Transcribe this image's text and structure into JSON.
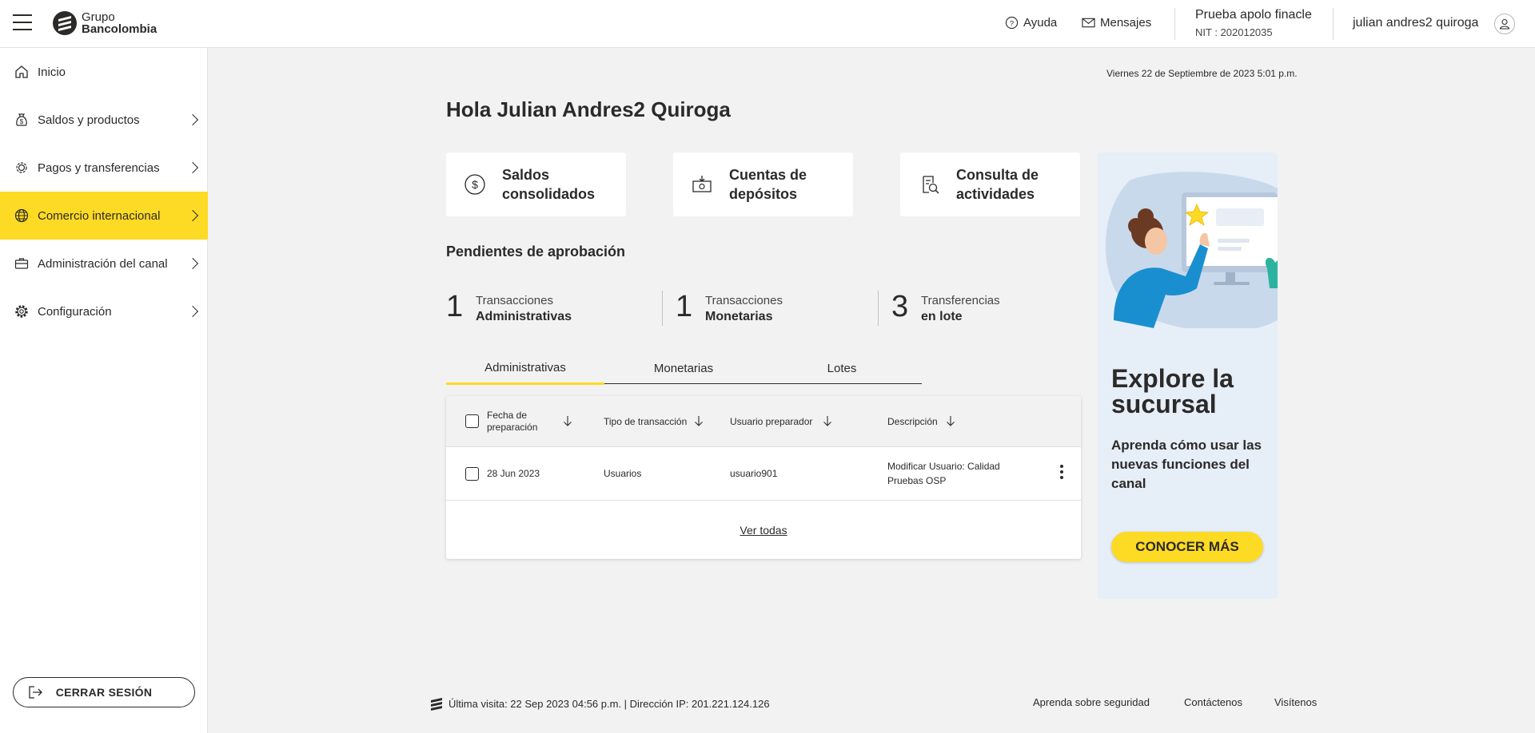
{
  "header": {
    "logo_line1": "Grupo",
    "logo_line2": "Bancolombia",
    "help_label": "Ayuda",
    "messages_label": "Mensajes",
    "company_name": "Prueba apolo finacle",
    "company_nit": "NIT : 202012035",
    "user_name": "julian andres2 quiroga"
  },
  "sidebar": {
    "items": [
      {
        "label": "Inicio",
        "icon": "home-icon"
      },
      {
        "label": "Saldos y productos",
        "icon": "money-bag-icon"
      },
      {
        "label": "Pagos y transferencias",
        "icon": "payment-gear-icon"
      },
      {
        "label": "Comercio internacional",
        "icon": "globe-icon"
      },
      {
        "label": "Administración del canal",
        "icon": "briefcase-icon"
      },
      {
        "label": "Configuración",
        "icon": "gear-icon"
      }
    ],
    "active_index": 3,
    "logout_label": "CERRAR SESIÓN"
  },
  "main": {
    "datetime": "Viernes 22 de Septiembre de 2023 5:01 p.m.",
    "greeting": "Hola Julian Andres2 Quiroga",
    "shortcuts": [
      {
        "line1": "Saldos",
        "line2": "consolidados",
        "icon": "dollar-circle-icon"
      },
      {
        "line1": "Cuentas de",
        "line2": "depósitos",
        "icon": "deposit-icon"
      },
      {
        "line1": "Consulta de",
        "line2": "actividades",
        "icon": "search-document-icon"
      }
    ],
    "pending_title": "Pendientes de aprobación",
    "pending": [
      {
        "count": "1",
        "label1": "Transacciones",
        "label2": "Administrativas"
      },
      {
        "count": "1",
        "label1": "Transacciones",
        "label2": "Monetarias"
      },
      {
        "count": "3",
        "label1": "Transferencias",
        "label2": "en lote"
      }
    ],
    "tabs": [
      "Administrativas",
      "Monetarias",
      "Lotes"
    ],
    "active_tab": 0,
    "table": {
      "columns": [
        "Fecha de preparación",
        "Tipo de transacción",
        "Usuario preparador",
        "Descripción"
      ],
      "rows": [
        {
          "date": "28 Jun 2023",
          "type": "Usuarios",
          "user": "usuario901",
          "description": "Modificar Usuario: Calidad Pruebas OSP"
        }
      ],
      "see_all": "Ver todas"
    }
  },
  "promo": {
    "title": "Explore la sucursal",
    "subtitle": "Aprenda cómo usar las nuevas funciones del canal",
    "button": "CONOCER MÁS"
  },
  "footer": {
    "last_visit": "Última visita: 22 Sep 2023 04:56 p.m. | Dirección IP: 201.221.124.126",
    "links": [
      "Aprenda sobre seguridad",
      "Contáctenos",
      "Visítenos"
    ]
  },
  "colors": {
    "accent": "#fdda24",
    "text": "#2c2a29",
    "background": "#f2f2f2",
    "promo_bg": "#e6eef8"
  }
}
